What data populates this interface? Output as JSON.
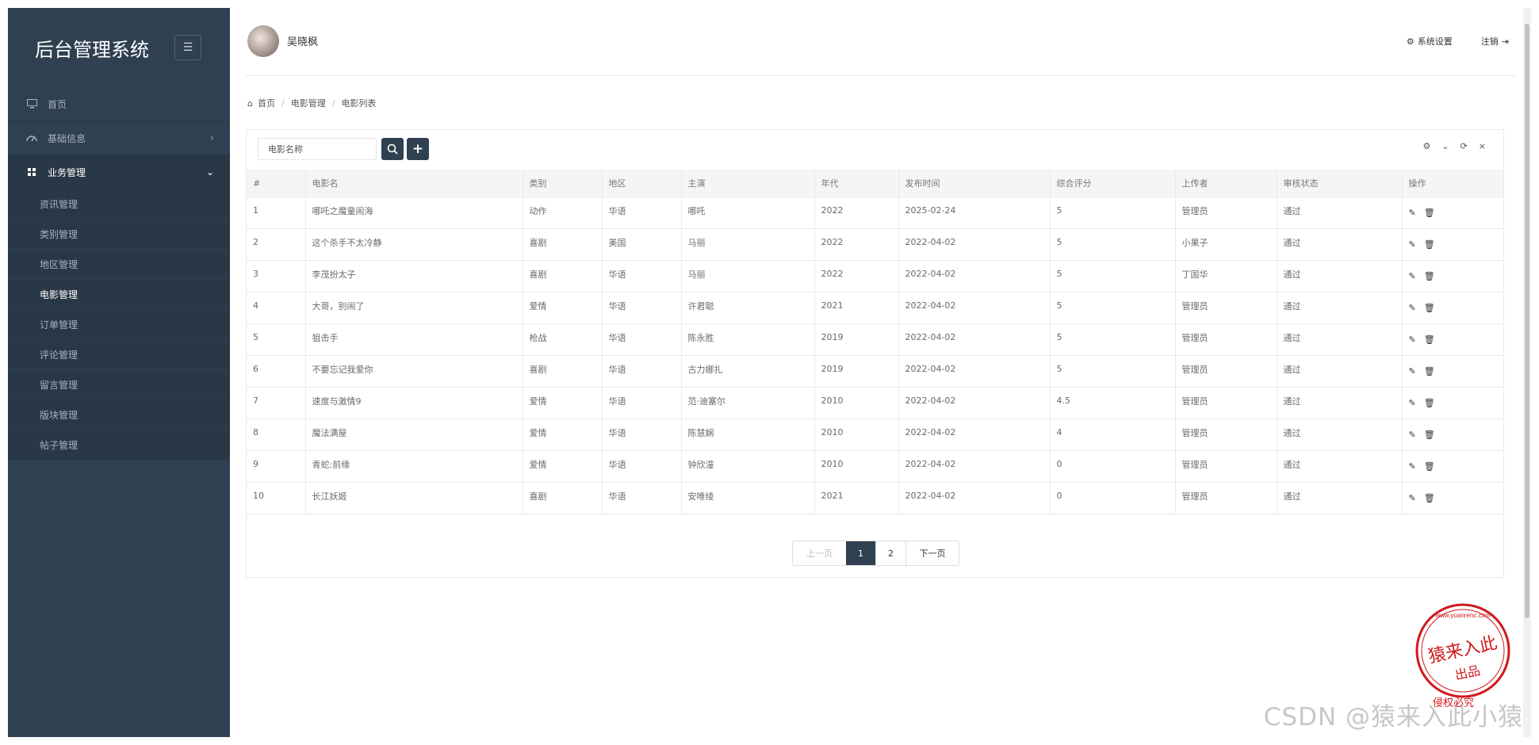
{
  "app": {
    "title": "后台管理系统"
  },
  "sidebar": {
    "items": [
      {
        "label": "首页",
        "icon": "desktop-icon"
      },
      {
        "label": "基础信息",
        "icon": "dashboard-icon"
      },
      {
        "label": "业务管理",
        "icon": "grid-icon"
      }
    ],
    "sub_items": [
      "资讯管理",
      "类别管理",
      "地区管理",
      "电影管理",
      "订单管理",
      "评论管理",
      "留言管理",
      "版块管理",
      "帖子管理"
    ],
    "active_sub": "电影管理"
  },
  "header": {
    "username": "吴晓枫",
    "settings_label": "系统设置",
    "logout_label": "注销"
  },
  "breadcrumb": {
    "items": [
      "首页",
      "电影管理",
      "电影列表"
    ]
  },
  "search": {
    "placeholder": "电影名称"
  },
  "table": {
    "columns": [
      "#",
      "电影名",
      "类别",
      "地区",
      "主演",
      "年代",
      "发布时间",
      "综合评分",
      "上传者",
      "审核状态",
      "操作"
    ],
    "rows": [
      [
        "1",
        "哪吒之魔童闹海",
        "动作",
        "华语",
        "哪吒",
        "2022",
        "2025-02-24",
        "5",
        "管理员",
        "通过"
      ],
      [
        "2",
        "这个杀手不太冷静",
        "喜剧",
        "美国",
        "马丽",
        "2022",
        "2022-04-02",
        "5",
        "小果子",
        "通过"
      ],
      [
        "3",
        "李茂扮太子",
        "喜剧",
        "华语",
        "马丽",
        "2022",
        "2022-04-02",
        "5",
        "丁国华",
        "通过"
      ],
      [
        "4",
        "大哥，别闹了",
        "爱情",
        "华语",
        "许君聪",
        "2021",
        "2022-04-02",
        "5",
        "管理员",
        "通过"
      ],
      [
        "5",
        "狙击手",
        "枪战",
        "华语",
        "陈永胜",
        "2019",
        "2022-04-02",
        "5",
        "管理员",
        "通过"
      ],
      [
        "6",
        "不要忘记我爱你",
        "喜剧",
        "华语",
        "古力娜扎",
        "2019",
        "2022-04-02",
        "5",
        "管理员",
        "通过"
      ],
      [
        "7",
        "速度与激情9",
        "爱情",
        "华语",
        "范·迪塞尔",
        "2010",
        "2022-04-02",
        "4.5",
        "管理员",
        "通过"
      ],
      [
        "8",
        "魔法满屋",
        "爱情",
        "华语",
        "陈慧娴",
        "2010",
        "2022-04-02",
        "4",
        "管理员",
        "通过"
      ],
      [
        "9",
        "青蛇:前缘",
        "爱情",
        "华语",
        "钟欣潼",
        "2010",
        "2022-04-02",
        "0",
        "管理员",
        "通过"
      ],
      [
        "10",
        "长江妖姬",
        "喜剧",
        "华语",
        "安唯绫",
        "2021",
        "2022-04-02",
        "0",
        "管理员",
        "通过"
      ]
    ]
  },
  "pagination": {
    "prev": "上一页",
    "pages": [
      "1",
      "2"
    ],
    "current": "1",
    "next": "下一页"
  },
  "watermark": "CSDN @猿来入此小猿",
  "seal": {
    "text": "猿来入此",
    "sub": "出品",
    "url": "www.yuanrenc.com",
    "bottom": "侵权必究"
  },
  "colors": {
    "sidebar_bg": "#2f4050",
    "accent": "#2f4050",
    "seal": "#d0191c"
  }
}
